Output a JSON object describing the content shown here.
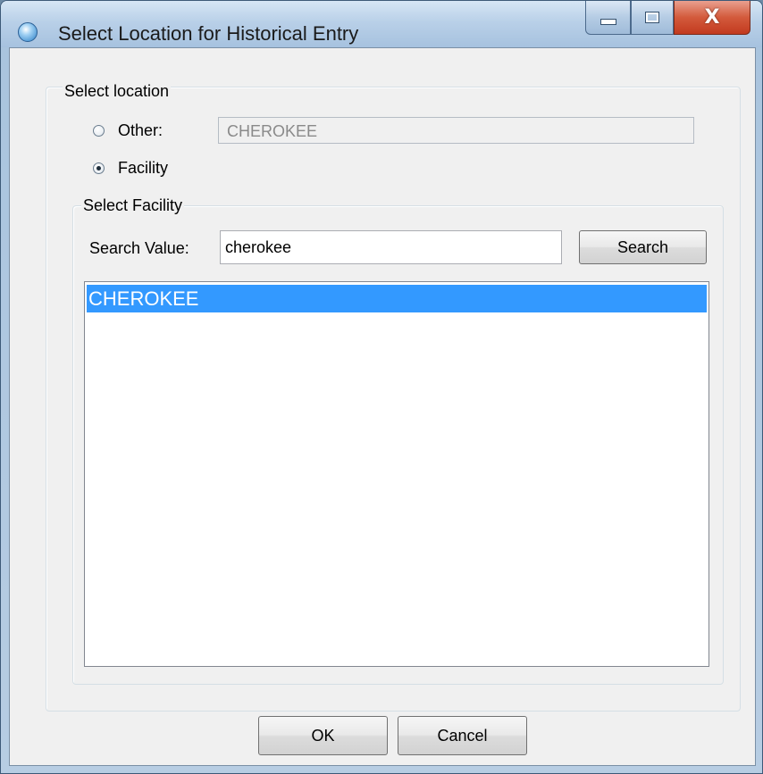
{
  "window": {
    "title": "Select Location for Historical Entry",
    "close_glyph": "X"
  },
  "location_group": {
    "label": "Select location",
    "option_other": {
      "label": "Other:",
      "selected": false
    },
    "option_facility": {
      "label": "Facility",
      "selected": true
    },
    "other_value": "CHEROKEE"
  },
  "facility_group": {
    "label": "Select Facility",
    "search_label": "Search Value:",
    "search_value": "cherokee",
    "search_button": "Search",
    "results": [
      {
        "label": "CHEROKEE",
        "selected": true
      }
    ]
  },
  "footer": {
    "ok_label": "OK",
    "cancel_label": "Cancel"
  },
  "colors": {
    "selection": "#3399ff",
    "close_button": "#c23a1f"
  }
}
